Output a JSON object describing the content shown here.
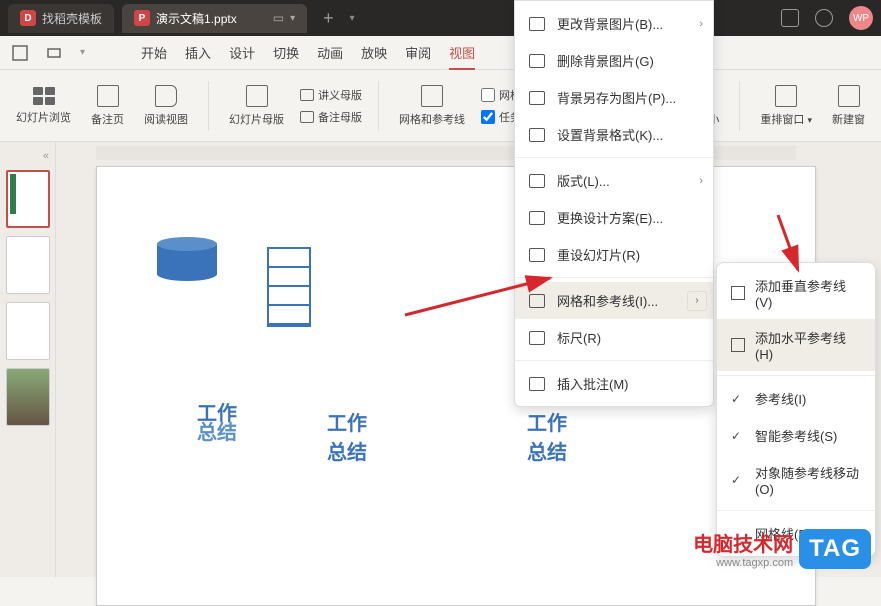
{
  "titlebar": {
    "tab1": "找稻壳模板",
    "tab2": "演示文稿1.pptx",
    "wp": "WP"
  },
  "menubar": {
    "items": [
      "开始",
      "插入",
      "设计",
      "切换",
      "动画",
      "放映",
      "审阅",
      "视图"
    ]
  },
  "ribbon": {
    "slide_preview": "幻灯片浏览",
    "notes_page": "备注页",
    "reading_view": "阅读视图",
    "slide_master": "幻灯片母版",
    "lecture_master": "讲义母版",
    "notes_master": "备注母版",
    "grid_guides": "网格和参考线",
    "grid_check": "网格线",
    "task_pane": "任务窗",
    "window_size": "口大小",
    "reorder_window": "重排窗口",
    "new_window": "新建窗"
  },
  "slide_labels": {
    "t1a": "工作",
    "t1b": "总结",
    "t2a": "工作",
    "t2b": "总结",
    "t3a": "工作",
    "t3b": "总结"
  },
  "ctx": {
    "change_bg": "更改背景图片(B)...",
    "del_bg": "删除背景图片(G)",
    "save_bg": "背景另存为图片(P)...",
    "bg_format": "设置背景格式(K)...",
    "layout": "版式(L)...",
    "design_scheme": "更换设计方案(E)...",
    "reset_slide": "重设幻灯片(R)",
    "grid_guides": "网格和参考线(I)...",
    "ruler": "标尺(R)",
    "insert_comment": "插入批注(M)"
  },
  "sub": {
    "add_v": "添加垂直参考线(V)",
    "add_h": "添加水平参考线(H)",
    "guides": "参考线(I)",
    "smart_guides": "智能参考线(S)",
    "obj_move": "对象随参考线移动(O)",
    "grid": "网格线(D)"
  },
  "watermark": {
    "title": "电脑技术网",
    "url": "www.tagxp.com",
    "tag": "TAG"
  }
}
